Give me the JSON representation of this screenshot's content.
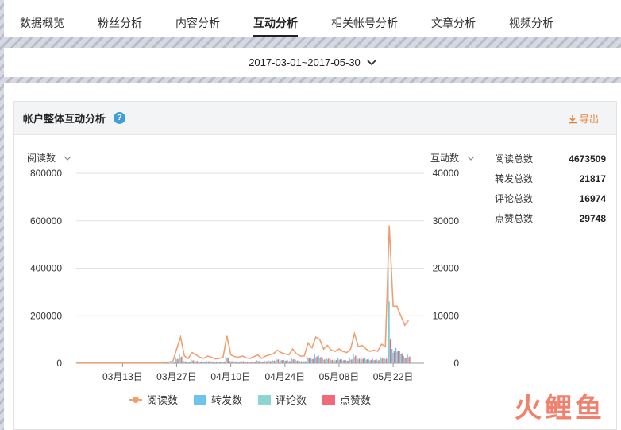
{
  "tabs": [
    {
      "label": "数据概览",
      "active": false
    },
    {
      "label": "粉丝分析",
      "active": false
    },
    {
      "label": "内容分析",
      "active": false
    },
    {
      "label": "互动分析",
      "active": true
    },
    {
      "label": "相关帐号分析",
      "active": false
    },
    {
      "label": "文章分析",
      "active": false
    },
    {
      "label": "视频分析",
      "active": false
    }
  ],
  "date_range": "2017-03-01~2017-05-30",
  "card": {
    "title": "帐户整体互动分析",
    "help_glyph": "?",
    "export_label": "导出"
  },
  "left_axis_label": "阅读数",
  "right_axis_label": "互动数",
  "summary": [
    {
      "label": "阅读总数",
      "value": "4673509"
    },
    {
      "label": "转发总数",
      "value": "21817"
    },
    {
      "label": "评论总数",
      "value": "16974"
    },
    {
      "label": "点赞总数",
      "value": "29748"
    }
  ],
  "watermark": "火鲤鱼",
  "colors": {
    "reads": "#f0a070",
    "shares": "#6ec3e8",
    "comments": "#8dd6d0",
    "likes": "#ef6b7a",
    "accent": "#e87e36"
  },
  "chart_data": {
    "type": "bar",
    "x_tick_labels": [
      "03月13日",
      "03月27日",
      "04月10日",
      "04月24日",
      "05月08日",
      "05月22日"
    ],
    "y_left": {
      "ticks": [
        0,
        200000,
        400000,
        600000,
        800000
      ],
      "range": [
        0,
        800000
      ]
    },
    "y_right": {
      "ticks": [
        0,
        10000,
        20000,
        30000,
        40000
      ],
      "range": [
        0,
        40000
      ]
    },
    "x": [
      "03-01",
      "03-02",
      "03-03",
      "03-04",
      "03-05",
      "03-06",
      "03-07",
      "03-08",
      "03-09",
      "03-10",
      "03-11",
      "03-12",
      "03-13",
      "03-14",
      "03-15",
      "03-16",
      "03-17",
      "03-18",
      "03-19",
      "03-20",
      "03-21",
      "03-22",
      "03-23",
      "03-24",
      "03-25",
      "03-26",
      "03-27",
      "03-28",
      "03-29",
      "03-30",
      "03-31",
      "04-01",
      "04-02",
      "04-03",
      "04-04",
      "04-05",
      "04-06",
      "04-07",
      "04-08",
      "04-09",
      "04-10",
      "04-11",
      "04-12",
      "04-13",
      "04-14",
      "04-15",
      "04-16",
      "04-17",
      "04-18",
      "04-19",
      "04-20",
      "04-21",
      "04-22",
      "04-23",
      "04-24",
      "04-25",
      "04-26",
      "04-27",
      "04-28",
      "04-29",
      "04-30",
      "05-01",
      "05-02",
      "05-03",
      "05-04",
      "05-05",
      "05-06",
      "05-07",
      "05-08",
      "05-09",
      "05-10",
      "05-11",
      "05-12",
      "05-13",
      "05-14",
      "05-15",
      "05-16",
      "05-17",
      "05-18",
      "05-19",
      "05-20",
      "05-21",
      "05-22",
      "05-23",
      "05-24",
      "05-25",
      "05-26",
      "05-27",
      "05-28",
      "05-29",
      "05-30"
    ],
    "series": [
      {
        "name": "阅读数",
        "axis": "left",
        "kind": "line",
        "values": [
          2000,
          2000,
          2000,
          2000,
          2000,
          2000,
          2000,
          2000,
          2000,
          2000,
          2000,
          2000,
          2000,
          2000,
          2000,
          2000,
          2000,
          2000,
          2000,
          2000,
          2000,
          2000,
          2000,
          3000,
          5000,
          8000,
          60000,
          110000,
          30000,
          20000,
          45000,
          35000,
          25000,
          20000,
          30000,
          25000,
          18000,
          20000,
          25000,
          115000,
          35000,
          28000,
          25000,
          30000,
          22000,
          20000,
          28000,
          35000,
          20000,
          30000,
          35000,
          40000,
          55000,
          45000,
          40000,
          35000,
          60000,
          40000,
          30000,
          30000,
          85000,
          65000,
          110000,
          100000,
          60000,
          75000,
          55000,
          50000,
          60000,
          50000,
          45000,
          60000,
          125000,
          70000,
          75000,
          60000,
          50000,
          55000,
          50000,
          80000,
          70000,
          580000,
          240000,
          240000,
          200000,
          160000,
          180000
        ]
      },
      {
        "name": "转发数",
        "axis": "right",
        "kind": "bar",
        "values": [
          0,
          0,
          0,
          0,
          0,
          0,
          0,
          0,
          0,
          0,
          0,
          0,
          0,
          0,
          0,
          0,
          0,
          0,
          0,
          0,
          0,
          0,
          0,
          50,
          100,
          200,
          1200,
          1800,
          500,
          300,
          800,
          600,
          400,
          300,
          500,
          400,
          300,
          300,
          400,
          1500,
          500,
          400,
          400,
          500,
          350,
          300,
          450,
          600,
          350,
          500,
          600,
          700,
          1000,
          800,
          700,
          600,
          1100,
          700,
          500,
          500,
          1500,
          1200,
          1800,
          1600,
          1000,
          1200,
          900,
          800,
          1000,
          800,
          700,
          1000,
          2000,
          1200,
          1200,
          1000,
          800,
          900,
          800,
          1300,
          1200,
          20000,
          3000,
          3200,
          2600,
          1500,
          1800
        ]
      },
      {
        "name": "评论数",
        "axis": "right",
        "kind": "bar",
        "values": [
          0,
          0,
          0,
          0,
          0,
          0,
          0,
          0,
          0,
          0,
          0,
          0,
          0,
          0,
          0,
          0,
          0,
          0,
          0,
          0,
          0,
          0,
          0,
          30,
          60,
          120,
          800,
          1200,
          350,
          200,
          550,
          400,
          300,
          200,
          350,
          300,
          200,
          200,
          300,
          1000,
          350,
          300,
          300,
          350,
          250,
          200,
          300,
          400,
          250,
          350,
          400,
          500,
          700,
          550,
          500,
          400,
          750,
          500,
          350,
          350,
          1000,
          800,
          1200,
          1100,
          700,
          800,
          600,
          550,
          700,
          550,
          500,
          700,
          1300,
          800,
          800,
          700,
          550,
          600,
          550,
          900,
          800,
          13000,
          2200,
          2400,
          1900,
          1100,
          1300
        ]
      },
      {
        "name": "点赞数",
        "axis": "right",
        "kind": "bar",
        "values": [
          0,
          0,
          0,
          0,
          0,
          0,
          0,
          0,
          0,
          0,
          0,
          0,
          0,
          0,
          0,
          0,
          0,
          0,
          0,
          0,
          0,
          0,
          0,
          40,
          80,
          150,
          900,
          1400,
          400,
          250,
          600,
          450,
          350,
          250,
          400,
          350,
          250,
          250,
          350,
          1200,
          400,
          350,
          350,
          400,
          300,
          250,
          350,
          450,
          300,
          400,
          450,
          550,
          800,
          650,
          550,
          450,
          850,
          550,
          400,
          400,
          1200,
          900,
          1400,
          1300,
          800,
          950,
          700,
          650,
          800,
          650,
          550,
          800,
          1600,
          950,
          950,
          800,
          650,
          700,
          650,
          1050,
          950,
          5000,
          2500,
          2600,
          2100,
          1200,
          1400
        ]
      }
    ]
  }
}
